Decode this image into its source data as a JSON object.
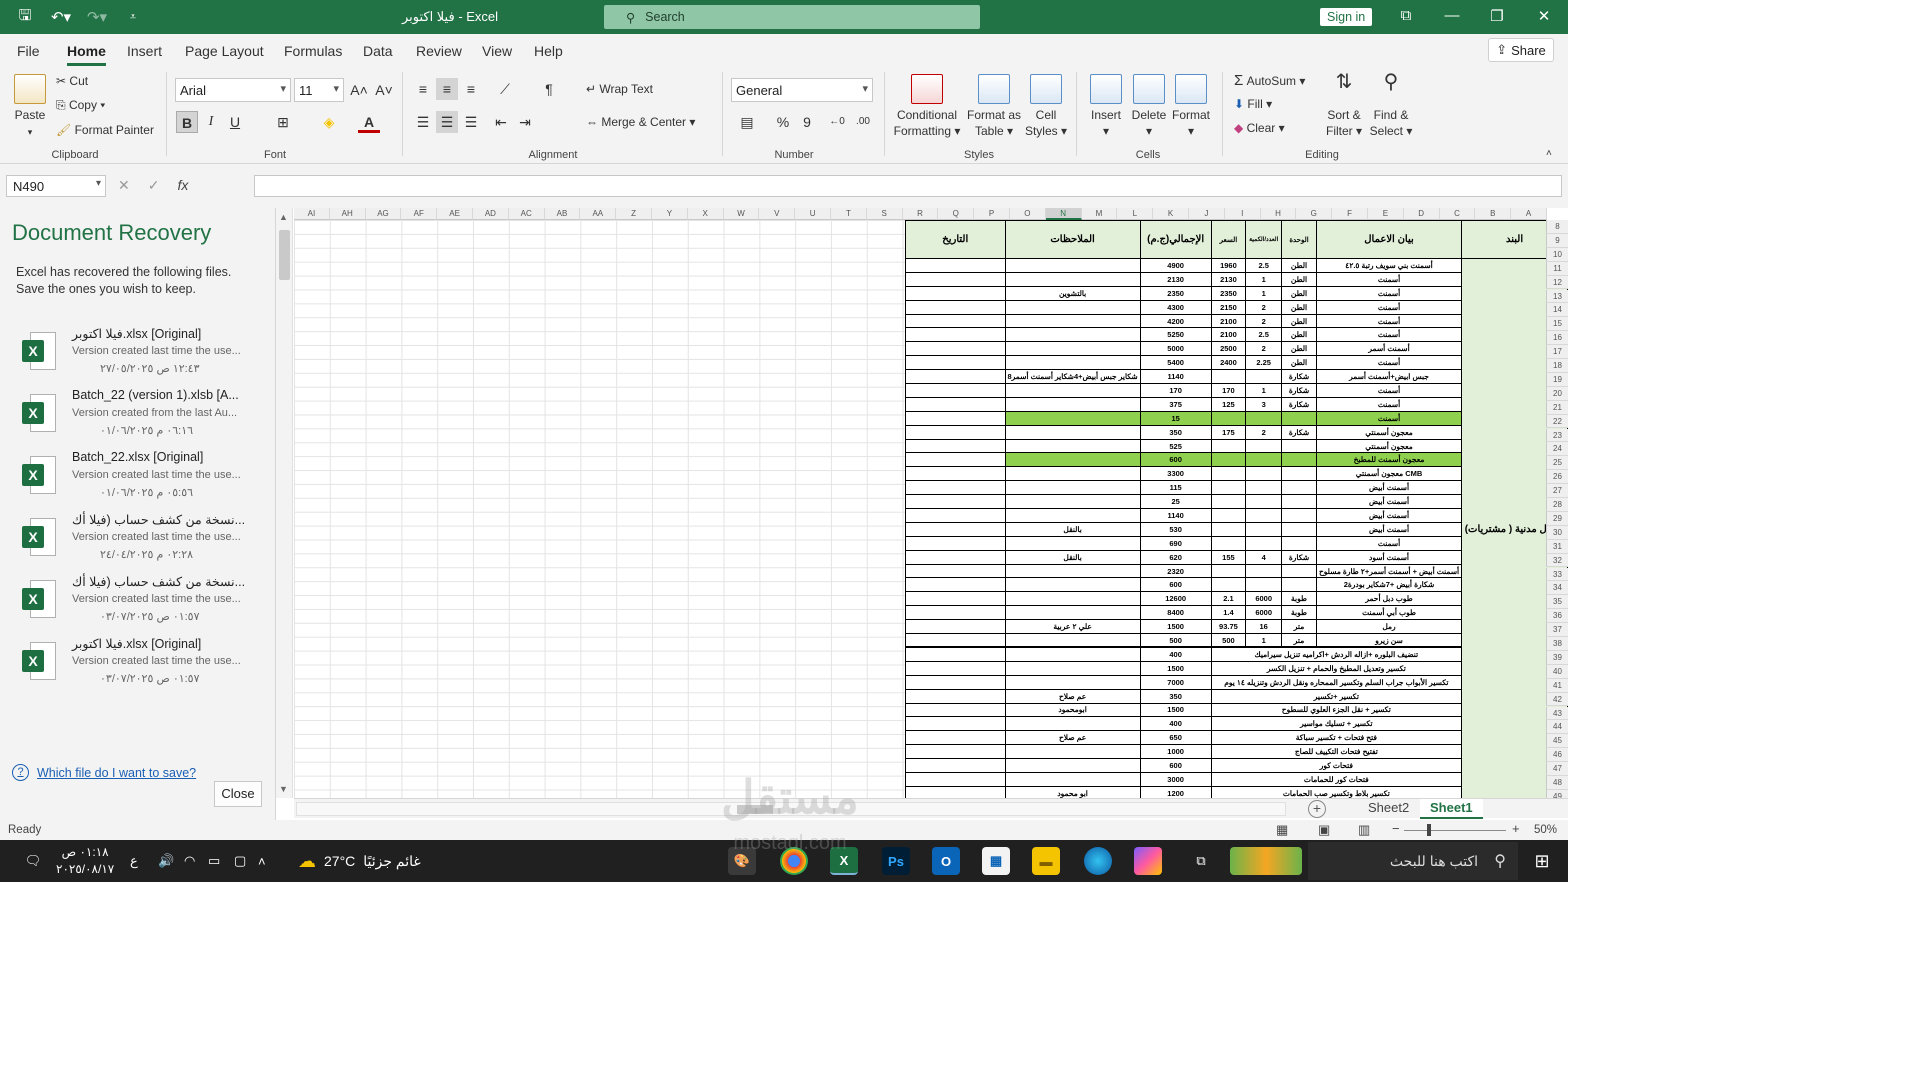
{
  "titlebar": {
    "title": "فيلا اكتوبر  -  Excel",
    "search_placeholder": "Search",
    "signin": "Sign in"
  },
  "menu": {
    "tabs": [
      "File",
      "Home",
      "Insert",
      "Page Layout",
      "Formulas",
      "Data",
      "Review",
      "View",
      "Help"
    ],
    "active": "Home",
    "share": "Share"
  },
  "ribbon": {
    "clipboard": {
      "paste": "Paste",
      "cut": "Cut",
      "copy": "Copy",
      "format_painter": "Format Painter",
      "label": "Clipboard"
    },
    "font": {
      "name": "Arial",
      "size": "11",
      "bold": "B",
      "italic": "I",
      "underline": "U",
      "label": "Font"
    },
    "alignment": {
      "wrap": "Wrap Text",
      "merge": "Merge & Center",
      "label": "Alignment"
    },
    "number": {
      "format": "General",
      "label": "Number"
    },
    "styles": {
      "conditional_1": "Conditional",
      "conditional_2": "Formatting",
      "format_table_1": "Format as",
      "format_table_2": "Table",
      "cell_styles_1": "Cell",
      "cell_styles_2": "Styles",
      "label": "Styles"
    },
    "cells": {
      "insert": "Insert",
      "delete": "Delete",
      "format": "Format",
      "label": "Cells"
    },
    "editing": {
      "autosum": "AutoSum",
      "fill": "Fill",
      "clear": "Clear",
      "sort_1": "Sort &",
      "sort_2": "Filter",
      "find_1": "Find &",
      "find_2": "Select",
      "label": "Editing"
    }
  },
  "formula_bar": {
    "name_box": "N490",
    "fx": "fx",
    "value": ""
  },
  "recovery": {
    "title": "Document Recovery",
    "description": "Excel has recovered the following files. Save the ones you wish to keep.",
    "files": [
      {
        "name": "فيلا اكتوبر.xlsx  [Original]",
        "version": "Version created last time the use...",
        "date": "١٢:٤٣ ص ٢٧/٠٥/٢٠٢٥"
      },
      {
        "name": "Batch_22 (version 1).xlsb  [A...",
        "version": "Version created from the last Au...",
        "date": "٠٦:١٦ م ٠١/٠٦/٢٠٢٥"
      },
      {
        "name": "Batch_22.xlsx  [Original]",
        "version": "Version created last time the use...",
        "date": "٠٥:٥٦ م ٠١/٠٦/٢٠٢٥"
      },
      {
        "name": "نسخة من كشف حساب (فيلا أك...",
        "version": "Version created last time the use...",
        "date": "٠٢:٢٨ م ٢٤/٠٤/٢٠٢٥"
      },
      {
        "name": "نسخة من كشف حساب (فيلا أك...",
        "version": "Version created last time the use...",
        "date": "٠١:٥٧ ص ٠٣/٠٧/٢٠٢٥"
      },
      {
        "name": "فيلا اكتوبر.xlsx  [Original]",
        "version": "Version created last time the use...",
        "date": "٠١:٥٧ ص ٠٣/٠٧/٢٠٢٥"
      }
    ],
    "help_link": "Which file do I want to save?",
    "close": "Close"
  },
  "grid": {
    "columns": [
      "AI",
      "AH",
      "AG",
      "AF",
      "AE",
      "AD",
      "AC",
      "AB",
      "AA",
      "Z",
      "Y",
      "X",
      "W",
      "V",
      "U",
      "T",
      "S",
      "R",
      "Q",
      "P",
      "O",
      "N",
      "M",
      "L",
      "K",
      "J",
      "I",
      "H",
      "G",
      "F",
      "E",
      "D",
      "C",
      "B",
      "A"
    ],
    "selected_column": "N",
    "row_numbers": [
      "8",
      "9",
      "10",
      "11",
      "12",
      "13",
      "14",
      "15",
      "16",
      "17",
      "18",
      "19",
      "20",
      "21",
      "22",
      "23",
      "24",
      "25",
      "26",
      "27",
      "28",
      "29",
      "30",
      "31",
      "32",
      "33",
      "34",
      "35",
      "36",
      "37",
      "38",
      "39",
      "40",
      "41",
      "42",
      "43",
      "44",
      "45",
      "46",
      "47",
      "48",
      "49"
    ],
    "headers": {
      "date": "التاريخ",
      "notes": "الملاحظات",
      "total": "الإجمالي(ج.م)",
      "price": "السعر",
      "qty": "العدد/الكمية",
      "unit": "الوحدة",
      "desc": "بيان الاعمال",
      "item": "البند"
    },
    "band_label": "أعمال مدنية ( مشتريات)",
    "rows": [
      {
        "notes": "",
        "total": "4900",
        "price": "1960",
        "qty": "2.5",
        "unit": "الطن",
        "desc": "أسمنت بني سويف رتبة ٤٢.٥",
        "green": false
      },
      {
        "notes": "",
        "total": "2130",
        "price": "2130",
        "qty": "1",
        "unit": "الطن",
        "desc": "أسمنت",
        "green": false
      },
      {
        "notes": "بالتشوين",
        "total": "2350",
        "price": "2350",
        "qty": "1",
        "unit": "الطن",
        "desc": "أسمنت",
        "green": false
      },
      {
        "notes": "",
        "total": "4300",
        "price": "2150",
        "qty": "2",
        "unit": "الطن",
        "desc": "أسمنت",
        "green": false
      },
      {
        "notes": "",
        "total": "4200",
        "price": "2100",
        "qty": "2",
        "unit": "الطن",
        "desc": "أسمنت",
        "green": false
      },
      {
        "notes": "",
        "total": "5250",
        "price": "2100",
        "qty": "2.5",
        "unit": "الطن",
        "desc": "أسمنت",
        "green": false
      },
      {
        "notes": "",
        "total": "5000",
        "price": "2500",
        "qty": "2",
        "unit": "الطن",
        "desc": "أسمنت أسمر",
        "green": false
      },
      {
        "notes": "",
        "total": "5400",
        "price": "2400",
        "qty": "2.25",
        "unit": "الطن",
        "desc": "أسمنت",
        "green": false
      },
      {
        "notes": "8شكاير جبس أبيض+4شكاير أسمنت أسمر",
        "total": "1140",
        "price": "",
        "qty": "",
        "unit": "شكارة",
        "desc": "جبس ابيض+أسمنت أسمر",
        "green": false
      },
      {
        "notes": "",
        "total": "170",
        "price": "170",
        "qty": "1",
        "unit": "شكارة",
        "desc": "أسمنت",
        "green": false
      },
      {
        "notes": "",
        "total": "375",
        "price": "125",
        "qty": "3",
        "unit": "شكارة",
        "desc": "أسمنت",
        "green": false
      },
      {
        "notes": "",
        "total": "15",
        "price": "",
        "qty": "",
        "unit": "",
        "desc": "أسمنت",
        "green": true
      },
      {
        "notes": "",
        "total": "350",
        "price": "175",
        "qty": "2",
        "unit": "شكارة",
        "desc": "معجون أسمنتي",
        "green": false
      },
      {
        "notes": "",
        "total": "525",
        "price": "",
        "qty": "",
        "unit": "",
        "desc": "معجون أسمنتي",
        "green": false
      },
      {
        "notes": "",
        "total": "600",
        "price": "",
        "qty": "",
        "unit": "",
        "desc": "معجون أسمنت للمطبخ",
        "green": true
      },
      {
        "notes": "",
        "total": "3300",
        "price": "",
        "qty": "",
        "unit": "",
        "desc": "معجون أسمنتي CMB",
        "green": false
      },
      {
        "notes": "",
        "total": "115",
        "price": "",
        "qty": "",
        "unit": "",
        "desc": "أسمنت أبيض",
        "green": false
      },
      {
        "notes": "",
        "total": "25",
        "price": "",
        "qty": "",
        "unit": "",
        "desc": "أسمنت أبيض",
        "green": false
      },
      {
        "notes": "",
        "total": "1140",
        "price": "",
        "qty": "",
        "unit": "",
        "desc": "أسمنت أبيض",
        "green": false
      },
      {
        "notes": "بالنقل",
        "total": "530",
        "price": "",
        "qty": "",
        "unit": "",
        "desc": "أسمنت أبيض",
        "green": false
      },
      {
        "notes": "",
        "total": "690",
        "price": "",
        "qty": "",
        "unit": "",
        "desc": "أسمنت",
        "green": false
      },
      {
        "notes": "بالنقل",
        "total": "620",
        "price": "155",
        "qty": "4",
        "unit": "شكارة",
        "desc": "أسمنت أسود",
        "green": false
      },
      {
        "notes": "",
        "total": "2320",
        "price": "",
        "qty": "",
        "unit": "",
        "desc": "أسمنت أبيض + أسمنت أسمر+٢ طارة مسلوح",
        "green": false
      },
      {
        "notes": "",
        "total": "600",
        "price": "",
        "qty": "",
        "unit": "",
        "desc": "2شكارة أبيض +7شكاير بودرة",
        "green": false
      },
      {
        "notes": "",
        "total": "12600",
        "price": "2.1",
        "qty": "6000",
        "unit": "طوبة",
        "desc": "طوب دبل أحمر",
        "green": false
      },
      {
        "notes": "",
        "total": "8400",
        "price": "1.4",
        "qty": "6000",
        "unit": "طوبة",
        "desc": "طوب أبي أسمنت",
        "green": false
      },
      {
        "notes": "علي ٢ عربية",
        "total": "1500",
        "price": "93.75",
        "qty": "16",
        "unit": "متر",
        "desc": "رمل",
        "green": false
      },
      {
        "notes": "",
        "total": "500",
        "price": "500",
        "qty": "1",
        "unit": "متر",
        "desc": "سن زيرو",
        "green": false
      }
    ],
    "rows2": [
      {
        "notes": "",
        "total": "400",
        "desc": "تنضيف البلوره +ازاله الردش +اكراميه تنزيل سيراميك"
      },
      {
        "notes": "",
        "total": "1500",
        "desc": "تكسير وتعديل المطبخ والحمام + تنزيل الكسر"
      },
      {
        "notes": "",
        "total": "7000",
        "desc": "تكسير الأبواب جراب السلم وتكسير الممحاره ونقل الردش وتنزيله ١٤ يوم"
      },
      {
        "notes": "عم صلاح",
        "total": "350",
        "desc": "تكسير +تكسير"
      },
      {
        "notes": "ابومحمود",
        "total": "1500",
        "desc": "تكسير + نقل الجزء العلوي للسطوح"
      },
      {
        "notes": "",
        "total": "400",
        "desc": "تكسير + تسليك مواسير"
      },
      {
        "notes": "عم صلاح",
        "total": "650",
        "desc": "فتح فتحات + تكسير سباكة"
      },
      {
        "notes": "",
        "total": "1000",
        "desc": "تفتيح فتحات التكييف للصاج"
      },
      {
        "notes": "",
        "total": "600",
        "desc": "فتحات كور"
      },
      {
        "notes": "",
        "total": "3000",
        "desc": "فتحات كور للحمامات"
      },
      {
        "notes": "ابو محمود",
        "total": "1200",
        "desc": "تكسير بلاط وتكسير صب الحمامات"
      }
    ]
  },
  "sheet_tabs": {
    "tabs": [
      "Sheet2",
      "Sheet1"
    ],
    "active": "Sheet1"
  },
  "status": {
    "ready": "Ready",
    "zoom": "50%"
  },
  "taskbar": {
    "time": "٠١:١٨ ص",
    "date": "٢٠٢٥/٠٨/١٧",
    "lang": "ع",
    "weather_temp": "27°C",
    "weather_text": "غائم جزئيًا",
    "search_placeholder": "اكتب هنا للبحث"
  },
  "watermark": {
    "arabic": "مستقل",
    "latin": "mostaql.com"
  },
  "colors": {
    "excel_green": "#217346",
    "band_green": "#e2f0d9",
    "highlight_green": "#8fd14f"
  }
}
